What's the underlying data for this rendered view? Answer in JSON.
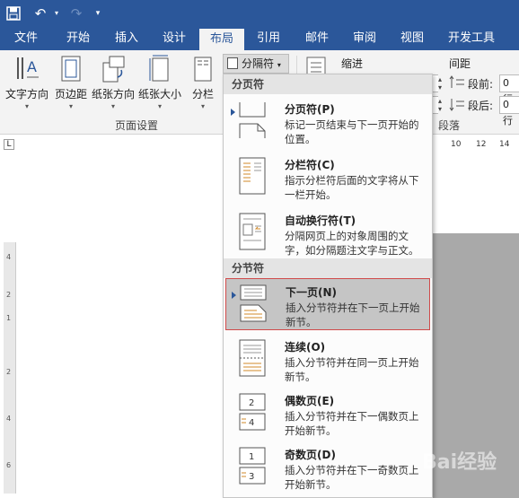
{
  "quick_access": {
    "save_icon": "save-icon",
    "undo_icon": "undo-icon",
    "redo_icon": "redo-icon",
    "customize_icon": "customize-icon"
  },
  "tabs": [
    "文件",
    "开始",
    "插入",
    "设计",
    "布局",
    "引用",
    "邮件",
    "审阅",
    "视图",
    "开发工具"
  ],
  "active_tab": "布局",
  "ribbon": {
    "buttons": [
      "文字方向",
      "页边距",
      "纸张方向",
      "纸张大小",
      "分栏"
    ],
    "group_page_setup": "页面设置",
    "breaks_label": "分隔符",
    "indent_label": "缩进",
    "spacing_label": "间距",
    "before_label": "段前:",
    "after_label": "段后:",
    "before_value": "0 行",
    "after_value": "0 行",
    "paragraph_label": "段落"
  },
  "ruler_h": [
    "10",
    "12",
    "14"
  ],
  "ruler_v": [
    "4",
    "2",
    "1",
    "2",
    "4",
    "6"
  ],
  "menu": {
    "page_breaks_head": "分页符",
    "section_breaks_head": "分节符",
    "items": [
      {
        "title": "分页符(P)",
        "desc": "标记一页结束与下一页开始的位置。"
      },
      {
        "title": "分栏符(C)",
        "desc": "指示分栏符后面的文字将从下一栏开始。"
      },
      {
        "title": "自动换行符(T)",
        "desc": "分隔网页上的对象周围的文字，如分隔题注文字与正文。"
      },
      {
        "title": "下一页(N)",
        "desc": "插入分节符并在下一页上开始新节。"
      },
      {
        "title": "连续(O)",
        "desc": "插入分节符并在同一页上开始新节。"
      },
      {
        "title": "偶数页(E)",
        "desc": "插入分节符并在下一偶数页上开始新节。"
      },
      {
        "title": "奇数页(D)",
        "desc": "插入分节符并在下一奇数页上开始新节。"
      }
    ]
  },
  "colors": {
    "accent": "#2b579a",
    "highlight_border": "#d04a4a"
  },
  "watermark": "Bai经验"
}
